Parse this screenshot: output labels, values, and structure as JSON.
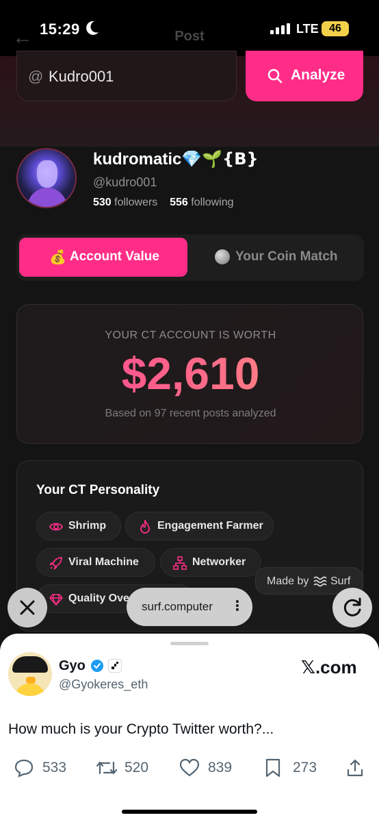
{
  "status_bar": {
    "time": "15:29",
    "network": "LTE",
    "battery": "46"
  },
  "behind_title": "Post",
  "search": {
    "at_symbol": "@",
    "value": "Kudro001",
    "button_label": "Analyze"
  },
  "profile": {
    "display_name": "kudromatic",
    "display_name_suffix": "💎🌱{B}",
    "username": "@kudro001",
    "followers_count": "530",
    "followers_label": "followers",
    "following_count": "556",
    "following_label": "following"
  },
  "tabs": [
    {
      "label": "Account Value",
      "icon": "money-bag-icon",
      "active": true
    },
    {
      "label": "Your Coin Match",
      "icon": "coin-icon",
      "active": false
    }
  ],
  "value_card": {
    "caption": "YOUR CT ACCOUNT IS WORTH",
    "amount": "$2,610",
    "note": "Based on 97 recent posts analyzed"
  },
  "personality": {
    "title": "Your CT Personality",
    "traits": [
      {
        "label": "Shrimp",
        "icon": "eye-icon"
      },
      {
        "label": "Engagement Farmer",
        "icon": "flame-icon"
      },
      {
        "label": "Viral Machine",
        "icon": "rocket-icon"
      },
      {
        "label": "Networker",
        "icon": "network-icon"
      },
      {
        "label": "Quality Ove",
        "icon": "diamond-icon"
      }
    ]
  },
  "made_by": {
    "label": "Made by",
    "brand": "Surf"
  },
  "browser": {
    "url": "surf.computer"
  },
  "tweet": {
    "name": "Gyo",
    "handle": "@Gyokeres_eth",
    "source": "𝕏.com",
    "text": "How much is your Crypto Twitter worth?...",
    "replies": "533",
    "reposts": "520",
    "likes": "839",
    "bookmarks": "273"
  },
  "colors": {
    "accent": "#ff2d87",
    "background": "#141414"
  }
}
